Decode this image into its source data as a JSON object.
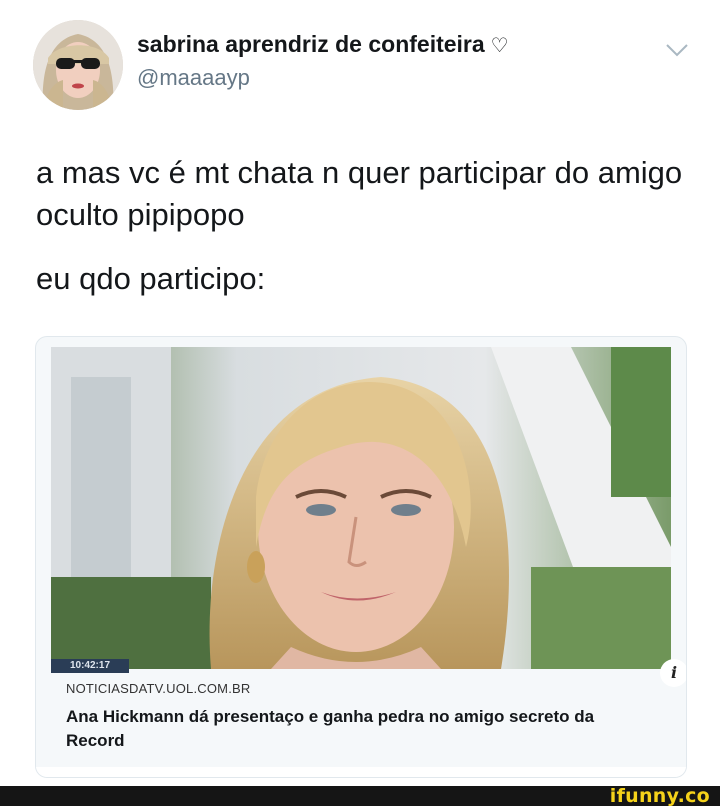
{
  "tweet": {
    "display_name": "sabrina aprendriz de confeiteira",
    "name_symbol": "♡",
    "handle": "@maaaayp",
    "paragraphs": [
      "a mas vc é mt chata n quer participar do amigo oculto pipipopo",
      "eu qdo participo:"
    ]
  },
  "card": {
    "timestamp": "10:42:17",
    "info_symbol": "i",
    "domain": "NOTICIASDATV.UOL.COM.BR",
    "title": "Ana Hickmann dá presentaço e ganha pedra no amigo secreto da Record"
  },
  "watermark": {
    "text": "ifunny.co"
  },
  "icons": {
    "menu": "chevron-down-icon",
    "info": "info-icon"
  }
}
